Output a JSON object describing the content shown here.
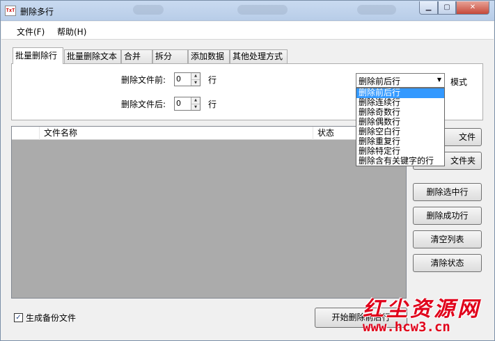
{
  "window": {
    "title": "删除多行",
    "icon_text": "TxT",
    "minimize_glyph": "▁",
    "maximize_glyph": "▢",
    "close_glyph": "✕"
  },
  "menu": {
    "items": [
      "文件(F)",
      "帮助(H)"
    ]
  },
  "tabs": [
    {
      "label": "批量删除行",
      "active": true
    },
    {
      "label": "批量删除文本",
      "active": false
    },
    {
      "label": "合并",
      "active": false
    },
    {
      "label": "拆分",
      "active": false
    },
    {
      "label": "添加数据",
      "active": false
    },
    {
      "label": "其他处理方式",
      "active": false
    }
  ],
  "options": {
    "before_label": "删除文件前:",
    "before_value": "0",
    "before_unit": "行",
    "after_label": "删除文件后:",
    "after_value": "0",
    "after_unit": "行",
    "mode_selected": "删除前后行",
    "mode_label": "模式",
    "mode_options": [
      "删除前后行",
      "删除连续行",
      "删除奇数行",
      "删除偶数行",
      "删除空白行",
      "删除重复行",
      "删除特定行",
      "删除含有关键字的行"
    ]
  },
  "file_list": {
    "columns": [
      "文件名称",
      "状态"
    ]
  },
  "buttons": {
    "add_file": "文件",
    "add_folder": "文件夹",
    "delete_selected": "删除选中行",
    "delete_success": "删除成功行",
    "clear_list": "清空列表",
    "clear_status": "清除状态",
    "start": "开始删除前后行"
  },
  "backup": {
    "label": "生成备份文件",
    "checked": true
  },
  "watermark": {
    "text": "红尘资源网",
    "url": "www.hcw3.cn",
    "color": "#e0001a"
  },
  "colors": {
    "selection": "#3399ff",
    "list_background": "#ababab"
  }
}
